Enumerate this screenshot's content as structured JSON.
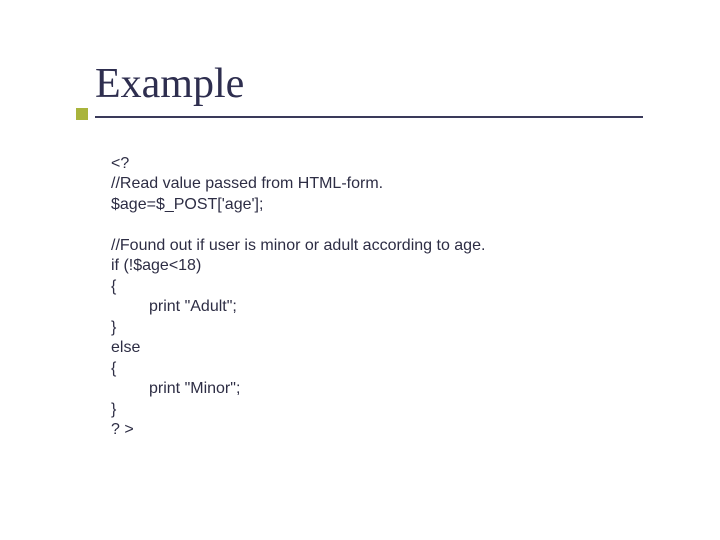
{
  "slide": {
    "title": "Example",
    "code": {
      "l1": "<?",
      "l2": "//Read value passed from HTML-form.",
      "l3": "$age=$_POST['age'];",
      "l4": "",
      "l5": "//Found out if user is minor or adult according to age.",
      "l6": "if (!$age<18)",
      "l7": "{",
      "l8": "print \"Adult\";",
      "l9": "}",
      "l10": "else",
      "l11": "{",
      "l12": "print \"Minor\";",
      "l13": "}",
      "l14": "? >"
    }
  }
}
